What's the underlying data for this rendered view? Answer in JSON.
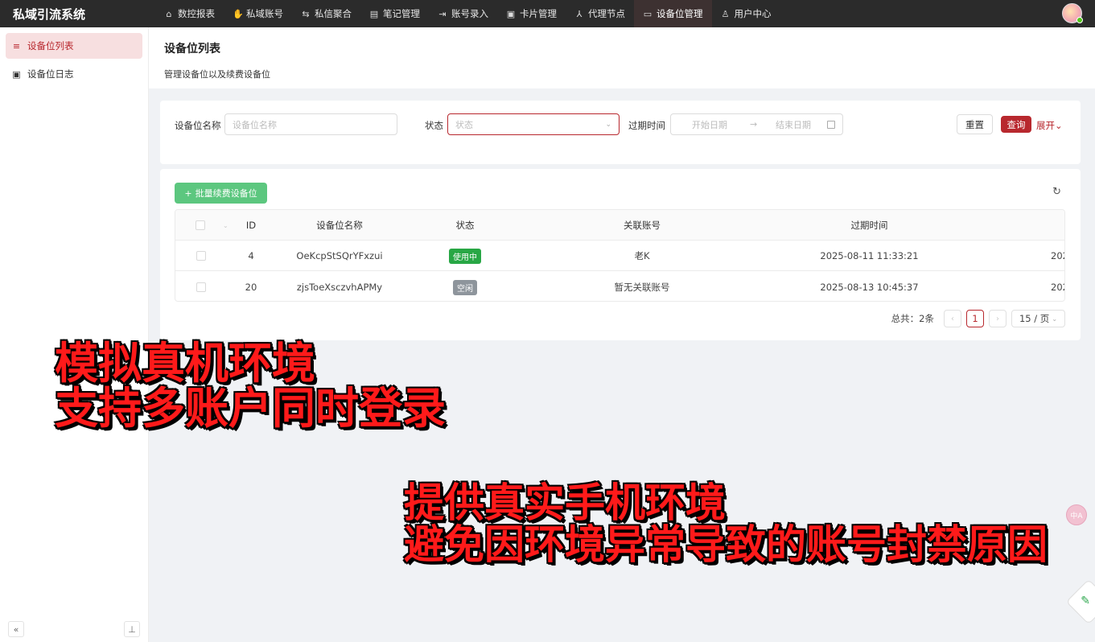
{
  "topbar": {
    "brand": "私域引流系统",
    "nav": [
      {
        "label": "数控报表",
        "icon": "home-chart-icon",
        "glyph": "⌂"
      },
      {
        "label": "私域账号",
        "icon": "hand-icon",
        "glyph": "✋"
      },
      {
        "label": "私信聚合",
        "icon": "chat-icon",
        "glyph": "⇆"
      },
      {
        "label": "笔记管理",
        "icon": "note-icon",
        "glyph": "▤"
      },
      {
        "label": "账号录入",
        "icon": "import-icon",
        "glyph": "⇥"
      },
      {
        "label": "卡片管理",
        "icon": "card-icon",
        "glyph": "▣"
      },
      {
        "label": "代理节点",
        "icon": "node-icon",
        "glyph": "⅄"
      },
      {
        "label": "设备位管理",
        "icon": "device-icon",
        "glyph": "▭",
        "active": true
      },
      {
        "label": "用户中心",
        "icon": "user-icon",
        "glyph": "♙"
      }
    ]
  },
  "sidebar": {
    "items": [
      {
        "label": "设备位列表",
        "icon": "list-icon",
        "glyph": "≡",
        "active": true
      },
      {
        "label": "设备位日志",
        "icon": "log-icon",
        "glyph": "▣"
      }
    ],
    "collapse_glyph": "«",
    "pin_glyph": "⊥"
  },
  "page": {
    "title": "设备位列表",
    "subtitle": "管理设备位以及续费设备位"
  },
  "filters": {
    "name_label": "设备位名称",
    "name_placeholder": "设备位名称",
    "status_label": "状态",
    "status_placeholder": "状态",
    "expire_label": "过期时间",
    "start_placeholder": "开始日期",
    "end_placeholder": "结束日期",
    "range_arrow": "→",
    "reset_label": "重置",
    "query_label": "查询",
    "expand_label": "展开",
    "expand_glyph": "⌄"
  },
  "table": {
    "batch_renew_label": "批量续费设备位",
    "batch_plus": "+",
    "refresh_glyph": "↻",
    "columns": {
      "id": "ID",
      "name": "设备位名称",
      "status": "状态",
      "account": "关联账号",
      "expire": "过期时间",
      "clipped": ""
    },
    "rows": [
      {
        "id": "4",
        "name": "OeKcpStSQrYFxzui",
        "status": "使用中",
        "status_color": "green",
        "account": "老K",
        "expire": "2025-08-11 11:33:21",
        "clipped": "202"
      },
      {
        "id": "20",
        "name": "zjsToeXsczvhAPMy",
        "status": "空闲",
        "status_color": "gray",
        "account": "暂无关联账号",
        "expire": "2025-08-13 10:45:37",
        "clipped": "202"
      }
    ]
  },
  "pagination": {
    "total": "总共：2条",
    "prev": "‹",
    "current": "1",
    "next": "›",
    "page_size": "15 / 页"
  },
  "overlay": {
    "line1": "模拟真机环境",
    "line2": "支持多账户同时登录",
    "line3": "提供真实手机环境",
    "line4": "避免因环境异常导致的账号封禁原因"
  },
  "floating": {
    "translate_glyph": "中A",
    "leaf_glyph": "✎"
  }
}
